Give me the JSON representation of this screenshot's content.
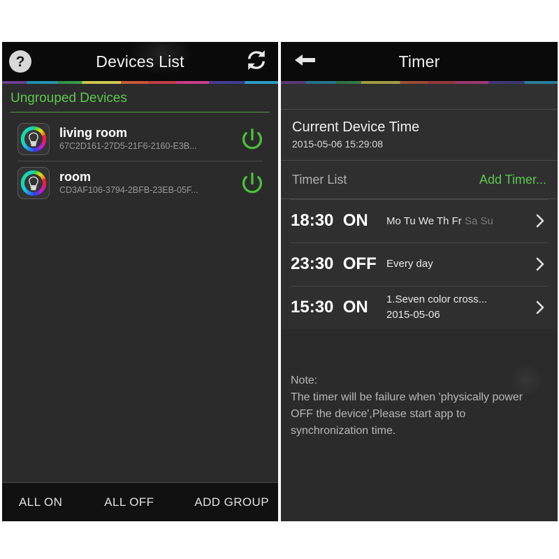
{
  "left_panel": {
    "navbar": {
      "help_icon_label": "?",
      "title": "Devices List",
      "refresh_icon": "refresh-sync-icon"
    },
    "group": {
      "title": "Ungrouped Devices"
    },
    "devices": [
      {
        "name": "living room",
        "uuid": "67C2D161-27D5-21F6-2160-E3B...",
        "icon": "rgb-bulb-icon",
        "power_icon": "power-icon",
        "power_color": "#4cc03c"
      },
      {
        "name": "room",
        "uuid": "CD3AF106-3794-2BFB-23EB-05F...",
        "icon": "rgb-bulb-icon",
        "power_icon": "power-icon",
        "power_color": "#4cc03c"
      }
    ],
    "bottom_bar": {
      "all_on": "ALL ON",
      "all_off": "ALL OFF",
      "add_group": "ADD GROUP"
    }
  },
  "right_panel": {
    "navbar": {
      "back_icon": "back-arrow-icon",
      "title": "Timer"
    },
    "device_time": {
      "label": "Current Device Time",
      "value": "2015-05-06 15:29:08"
    },
    "timer_list_bar": {
      "label": "Timer List",
      "add_label": "Add Timer..."
    },
    "timers": [
      {
        "time": "18:30",
        "state": "ON",
        "days_on": "Mo Tu We Th Fr",
        "days_off": "Sa Su",
        "sub": "",
        "chevron": "chevron-right-icon"
      },
      {
        "time": "23:30",
        "state": "OFF",
        "days_on": "",
        "days_off": "",
        "sub": "Every day",
        "chevron": "chevron-right-icon"
      },
      {
        "time": "15:30",
        "state": "ON",
        "days_on": "",
        "days_off": "",
        "sub": "1.Seven color cross...",
        "sub2": "2015-05-06",
        "chevron": "chevron-right-icon"
      }
    ],
    "note": {
      "line1": "Note:",
      "line2": "The timer will be failure when 'physically power",
      "line3": "OFF the device',Please start app to",
      "line4": "synchronization time."
    }
  },
  "colors": {
    "accent_green": "#5ec84f",
    "power_green": "#4cc03c",
    "panel_bg": "#2b2b2b",
    "navbar_bg": "#0a0a0a",
    "row_bg": "#2f2f2f",
    "muted_text": "#9a9a9a"
  }
}
